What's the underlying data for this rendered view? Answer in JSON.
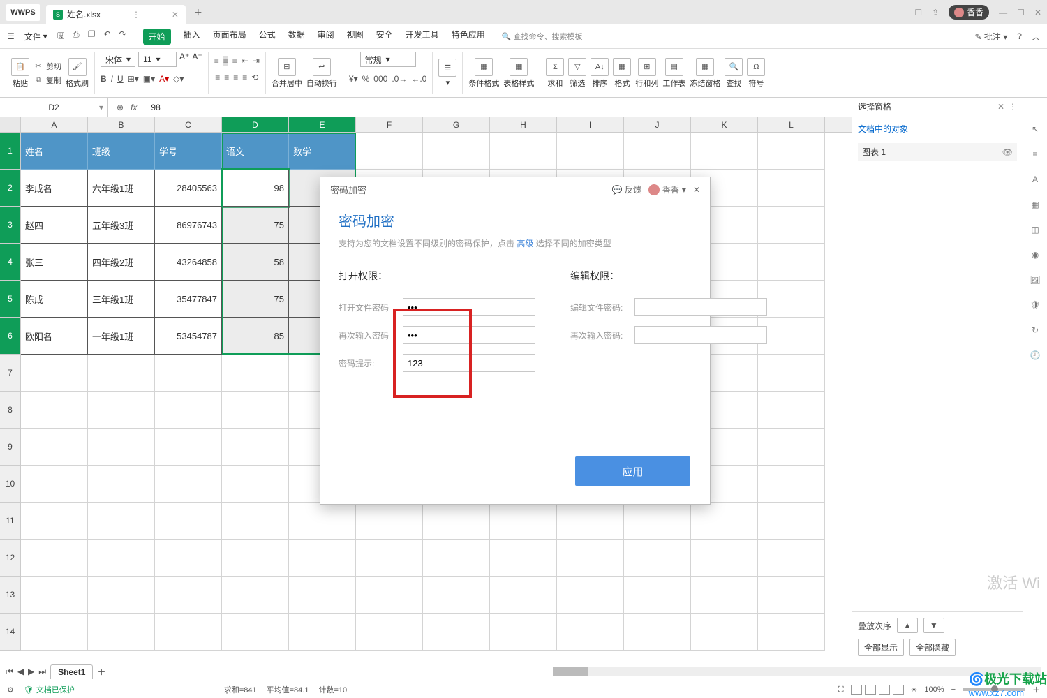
{
  "titlebar": {
    "app_label": "WPS",
    "doc_name": "姓名.xlsx",
    "doc_icon": "S",
    "win_icon1": "☐",
    "user_name": "香香"
  },
  "menu": {
    "file": "文件",
    "tabs": [
      "开始",
      "插入",
      "页面布局",
      "公式",
      "数据",
      "审阅",
      "视图",
      "安全",
      "开发工具",
      "特色应用"
    ],
    "search_ph": "查找命令、搜索模板",
    "annotate": "批注"
  },
  "ribbon": {
    "paste": "粘贴",
    "cut": "剪切",
    "copy": "复制",
    "fmtpaint": "格式刷",
    "font_name": "宋体",
    "font_size": "11",
    "merge": "合并居中",
    "wrap": "自动换行",
    "num_fmt": "常规",
    "cond": "条件格式",
    "tblstyle": "表格样式",
    "sum": "求和",
    "filter": "筛选",
    "sort": "排序",
    "format": "格式",
    "rowcol": "行和列",
    "worksheet": "工作表",
    "freeze": "冻结窗格",
    "find": "查找",
    "symbol": "符号"
  },
  "formula": {
    "cell_ref": "D2",
    "fx": "fx",
    "value": "98"
  },
  "cols": [
    "A",
    "B",
    "C",
    "D",
    "E",
    "F",
    "G",
    "H",
    "I",
    "J",
    "K",
    "L"
  ],
  "table": {
    "headers": [
      "姓名",
      "班级",
      "学号",
      "语文",
      "数学"
    ],
    "rows": [
      [
        "李成名",
        "六年级1班",
        "28405563",
        "98",
        ""
      ],
      [
        "赵四",
        "五年级3班",
        "86976743",
        "75",
        ""
      ],
      [
        "张三",
        "四年级2班",
        "43264858",
        "58",
        ""
      ],
      [
        "陈成",
        "三年级1班",
        "35477847",
        "75",
        ""
      ],
      [
        "欧阳名",
        "一年级1班",
        "53454787",
        "85",
        ""
      ]
    ]
  },
  "taskpane": {
    "title": "选择窗格",
    "section": "文档中的对象",
    "item1": "图表 1",
    "stack": "叠放次序",
    "showall": "全部显示",
    "hideall": "全部隐藏"
  },
  "sheets": {
    "name": "Sheet1"
  },
  "status": {
    "protected": "文档已保护",
    "sum": "求和=841",
    "avg": "平均值=84.1",
    "count": "计数=10",
    "zoom": "100%"
  },
  "dialog": {
    "title": "密码加密",
    "feedback": "反馈",
    "user": "香香",
    "heading": "密码加密",
    "sub_pre": "支持为您的文档设置不同级别的密码保护，点击 ",
    "sub_link": "高级",
    "sub_post": " 选择不同的加密类型",
    "open_perm": "打开权限：",
    "edit_perm": "编辑权限：",
    "open_pw": "打开文件密码",
    "open_pw2": "再次输入密码",
    "open_hint": "密码提示:",
    "edit_pw": "编辑文件密码:",
    "edit_pw2": "再次输入密码:",
    "hint_val": "123",
    "pw_val": "•••",
    "apply": "应用"
  },
  "watermark": "激活 Wi",
  "logo": {
    "brand": "极光下载站",
    "url": "www.xz7.com"
  }
}
